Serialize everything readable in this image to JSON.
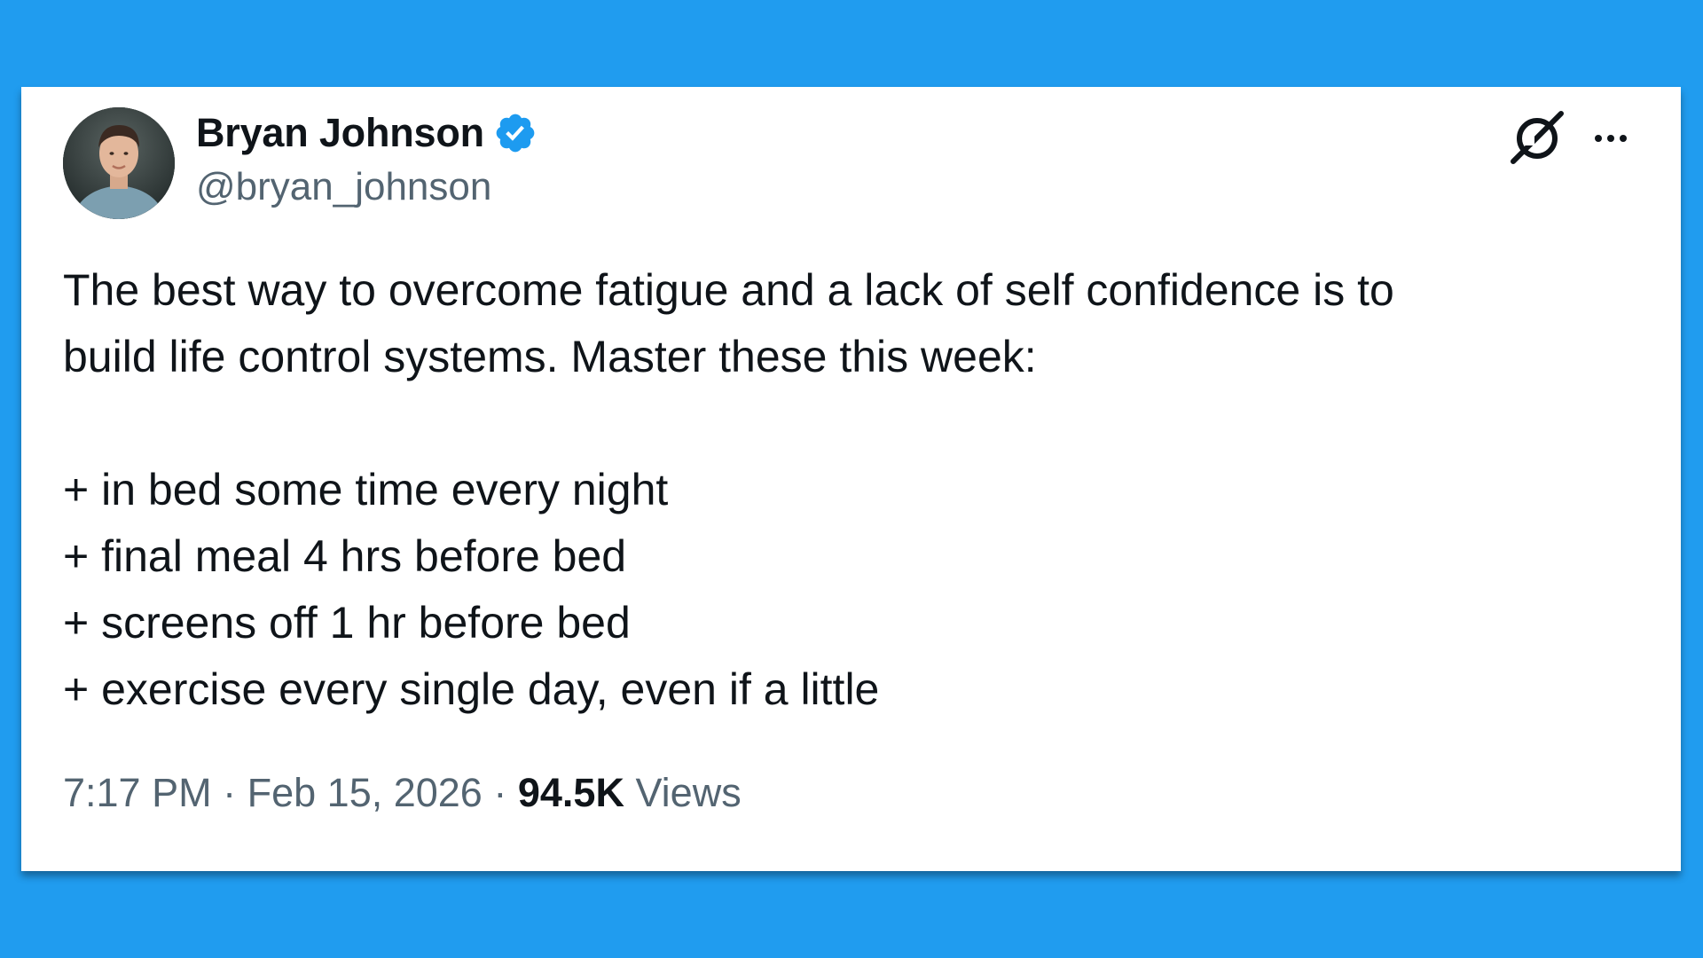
{
  "author": {
    "display_name": "Bryan Johnson",
    "handle": "@bryan_johnson",
    "verified": true
  },
  "tweet": {
    "intro_lines": [
      "The best way to overcome fatigue and a lack of self confidence is to",
      "build life control systems. Master these this week:"
    ],
    "list_items": [
      "+ in bed some time every night",
      "+ final meal 4 hrs before bed",
      "+ screens off 1 hr before bed",
      "+ exercise every single day, even if a little"
    ]
  },
  "meta": {
    "time": "7:17 PM",
    "separator": "·",
    "date": "Feb 15, 2026",
    "views_count": "94.5K",
    "views_label": "Views"
  },
  "icons": {
    "grok": "grok-icon",
    "more": "more-options-icon",
    "verified": "verified-badge-icon"
  },
  "colors": {
    "background": "#209cef",
    "verified": "#1d9bf0",
    "text_primary": "#0f1419",
    "text_secondary": "#536471"
  }
}
